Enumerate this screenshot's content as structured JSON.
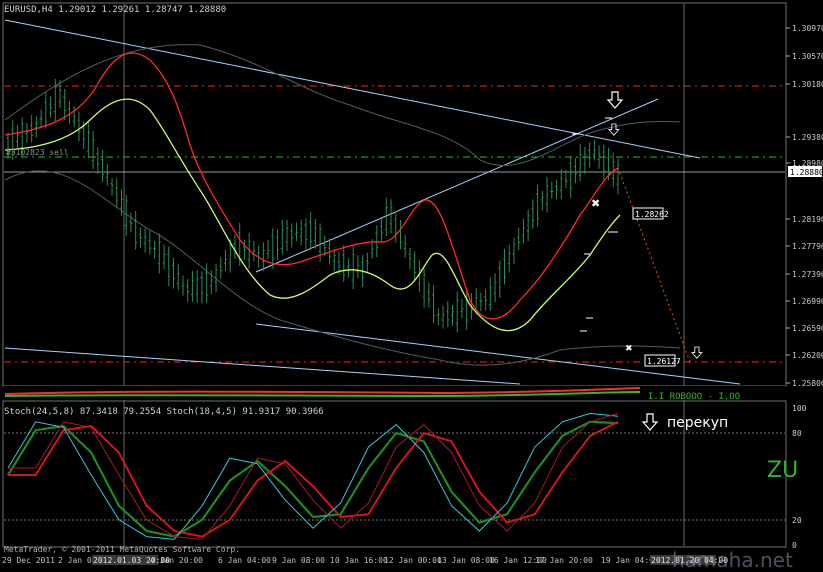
{
  "window": {
    "title": "EURUSD,H4",
    "ohlc": "1.29012 1.29261 1.28747 1.28880",
    "object_label": "#3102823 sell",
    "copyright": "MetaTrader, © 2001-2011 MetaQuotes Software Corp.",
    "watermark": "hamaha.net",
    "overbought_note": "перекуп",
    "zu_text": "ZU"
  },
  "stoch_header": "Stoch(24,5,8) 87.3418 79.2554  Stoch(18,4,5) 91.9317 90.3966",
  "price_axis": [
    "1.30970",
    "1.30570",
    "1.30180",
    "1.29380",
    "1.28980",
    "1.28190",
    "1.27790",
    "1.27390",
    "1.26990",
    "1.26590",
    "1.26200",
    "1.25800"
  ],
  "current_price": "1.28880",
  "stoch_axis": [
    "100",
    "80",
    "20",
    "0"
  ],
  "time_axis": [
    "29 Dec 2011",
    "2 Jan 04:00",
    "2012.01.03 20:00",
    "4 Jan 20:00",
    "6 Jan 04:00",
    "9 Jan 08:00",
    "10 Jan 16:00",
    "12 Jan 00:00",
    "13 Jan 08:00",
    "16 Jan 12:00",
    "17 Jan 20:00",
    "19 Jan 04:00",
    "2012.01.20 04:00"
  ],
  "price_tags": [
    "1.28262",
    "1.26127"
  ],
  "colors": {
    "background": "#000000",
    "candle": "#2e8b57",
    "ma_fast": "#ff2a2a",
    "ma_slow": "#c8ff64",
    "channel": "#a8d0ff",
    "envelope": "#4a6060",
    "level": "#ff2020",
    "level_green": "#20c020"
  },
  "icons": [
    "arrow-down-icon",
    "cross-marker-icon"
  ],
  "chart_data": {
    "type": "candlestick",
    "title": "EURUSD,H4",
    "ylim": [
      1.2565,
      1.3115
    ],
    "x": [
      "29 Dec 2011",
      "2 Jan 04:00",
      "2012.01.03 20:00",
      "4 Jan 20:00",
      "6 Jan 04:00",
      "9 Jan 08:00",
      "10 Jan 16:00",
      "12 Jan 00:00",
      "13 Jan 08:00",
      "16 Jan 12:00",
      "17 Jan 20:00",
      "19 Jan 04:00",
      "2012.01.20 04:00"
    ],
    "closes": [
      1.2936,
      1.2958,
      1.3012,
      1.295,
      1.288,
      1.28,
      1.2765,
      1.271,
      1.272,
      1.278,
      1.276,
      1.2795,
      1.28,
      1.275,
      1.274,
      1.283,
      1.2745,
      1.2665,
      1.268,
      1.27,
      1.278,
      1.285,
      1.288,
      1.2925,
      1.2888
    ],
    "series": [
      {
        "name": "Stoch(24,5,8)",
        "values": [
          50,
          82,
          85,
          66,
          28,
          10,
          6,
          18,
          46,
          60,
          42,
          20,
          22,
          55,
          80,
          74,
          38,
          16,
          22,
          52,
          78,
          88,
          87
        ]
      },
      {
        "name": "Stoch(18,4,5)",
        "values": [
          55,
          88,
          84,
          50,
          18,
          6,
          4,
          28,
          62,
          58,
          32,
          12,
          30,
          70,
          86,
          66,
          28,
          10,
          30,
          70,
          88,
          94,
          92
        ]
      }
    ],
    "stoch_ylim": [
      0,
      100
    ]
  }
}
